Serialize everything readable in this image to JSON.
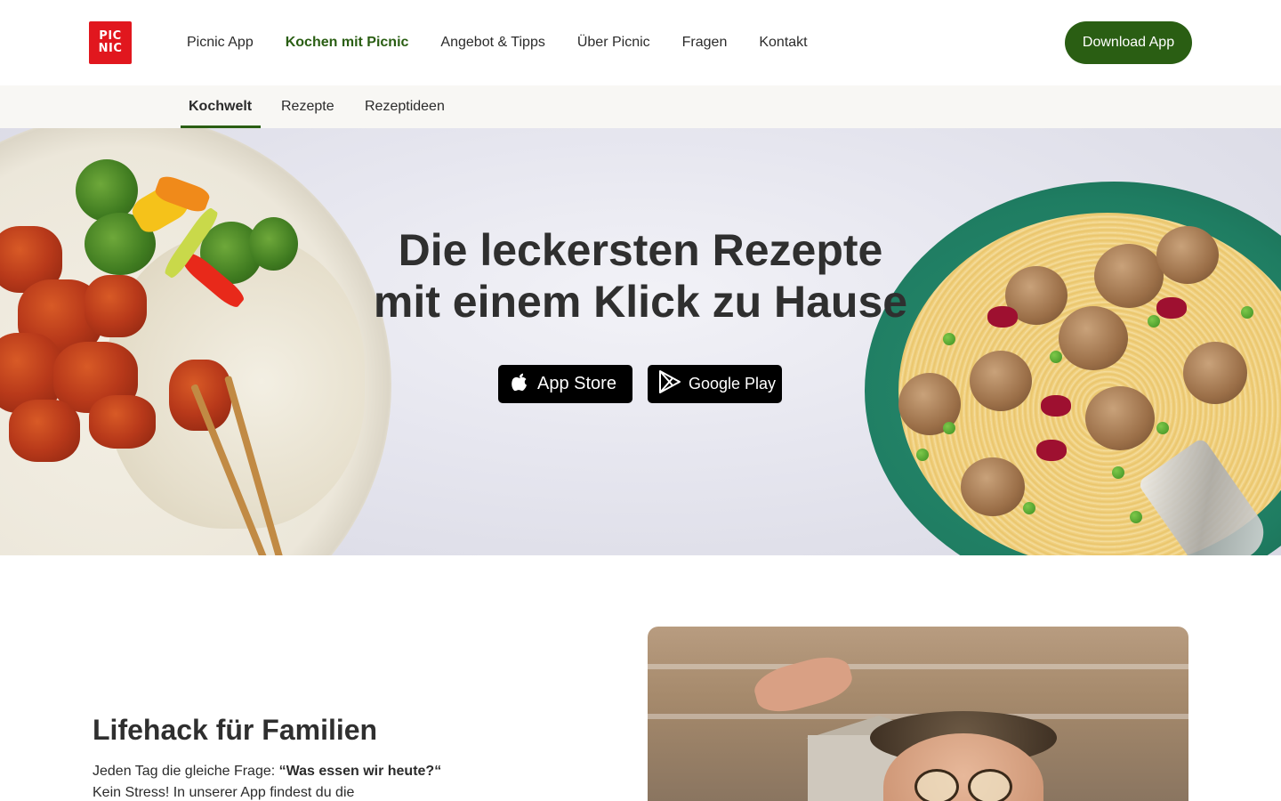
{
  "brand": {
    "logo_line1": "PIC",
    "logo_line2": "NIC",
    "color": "#e1171e"
  },
  "nav": {
    "items": [
      {
        "label": "Picnic App"
      },
      {
        "label": "Kochen mit Picnic",
        "active": true
      },
      {
        "label": "Angebot & Tipps"
      },
      {
        "label": "Über Picnic"
      },
      {
        "label": "Fragen"
      },
      {
        "label": "Kontakt"
      }
    ],
    "download_label": "Download App",
    "accent": "#2a5e13"
  },
  "subnav": {
    "tabs": [
      {
        "label": "Kochwelt",
        "active": true
      },
      {
        "label": "Rezepte"
      },
      {
        "label": "Rezeptideen"
      }
    ]
  },
  "hero": {
    "title_line1": "Die leckersten Rezepte",
    "title_line2": "mit einem Klick zu Hause",
    "app_store_label": "App Store",
    "google_play_label": "Google Play",
    "app_store_icon": "apple-icon",
    "google_play_icon": "play-store-icon"
  },
  "section": {
    "title": "Lifehack für Familien",
    "text_prefix": "Jeden Tag die gleiche Frage: ",
    "text_bold1": "“Was essen wir heute?“",
    "text_suffix": " Kein Stress! In unserer App findest du die"
  }
}
